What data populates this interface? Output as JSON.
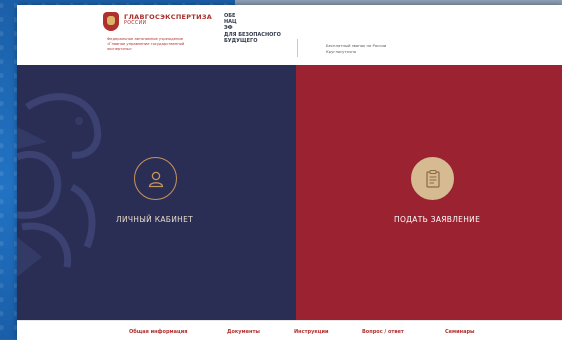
{
  "header": {
    "brand": "ГЛАВГОСЭКСПЕРТИЗА",
    "brand_sub": "РОССИИ",
    "org_line1": "Федеральное автономное учреждение",
    "org_line2": "«Главное управление государственной",
    "org_line3": "экспертизы»",
    "slogan_1": "ОБЕ",
    "slogan_2": "НАЦ",
    "slogan_3": "ЭФ",
    "slogan_4": "ДЛЯ БЕЗОПАСНОГО",
    "slogan_5": "БУДУЩЕГО",
    "info_line1": "Бесплатный звонок по России",
    "info_line2": "Круглосуточно"
  },
  "panels": {
    "cabinet_label": "ЛИЧНЫЙ КАБИНЕТ",
    "apply_label": "ПОДАТЬ ЗАЯВЛЕНИЕ"
  },
  "nav": {
    "items": [
      "Общая информация",
      "Документы",
      "Инструкции",
      "Вопрос / ответ",
      "Семинары"
    ]
  },
  "colors": {
    "left_panel": "#2a2e55",
    "right_panel": "#9b2231",
    "accent_gold": "#c7945a",
    "brand_red": "#b0302e"
  },
  "icons": {
    "cabinet": "user-icon",
    "apply": "clipboard-icon"
  }
}
